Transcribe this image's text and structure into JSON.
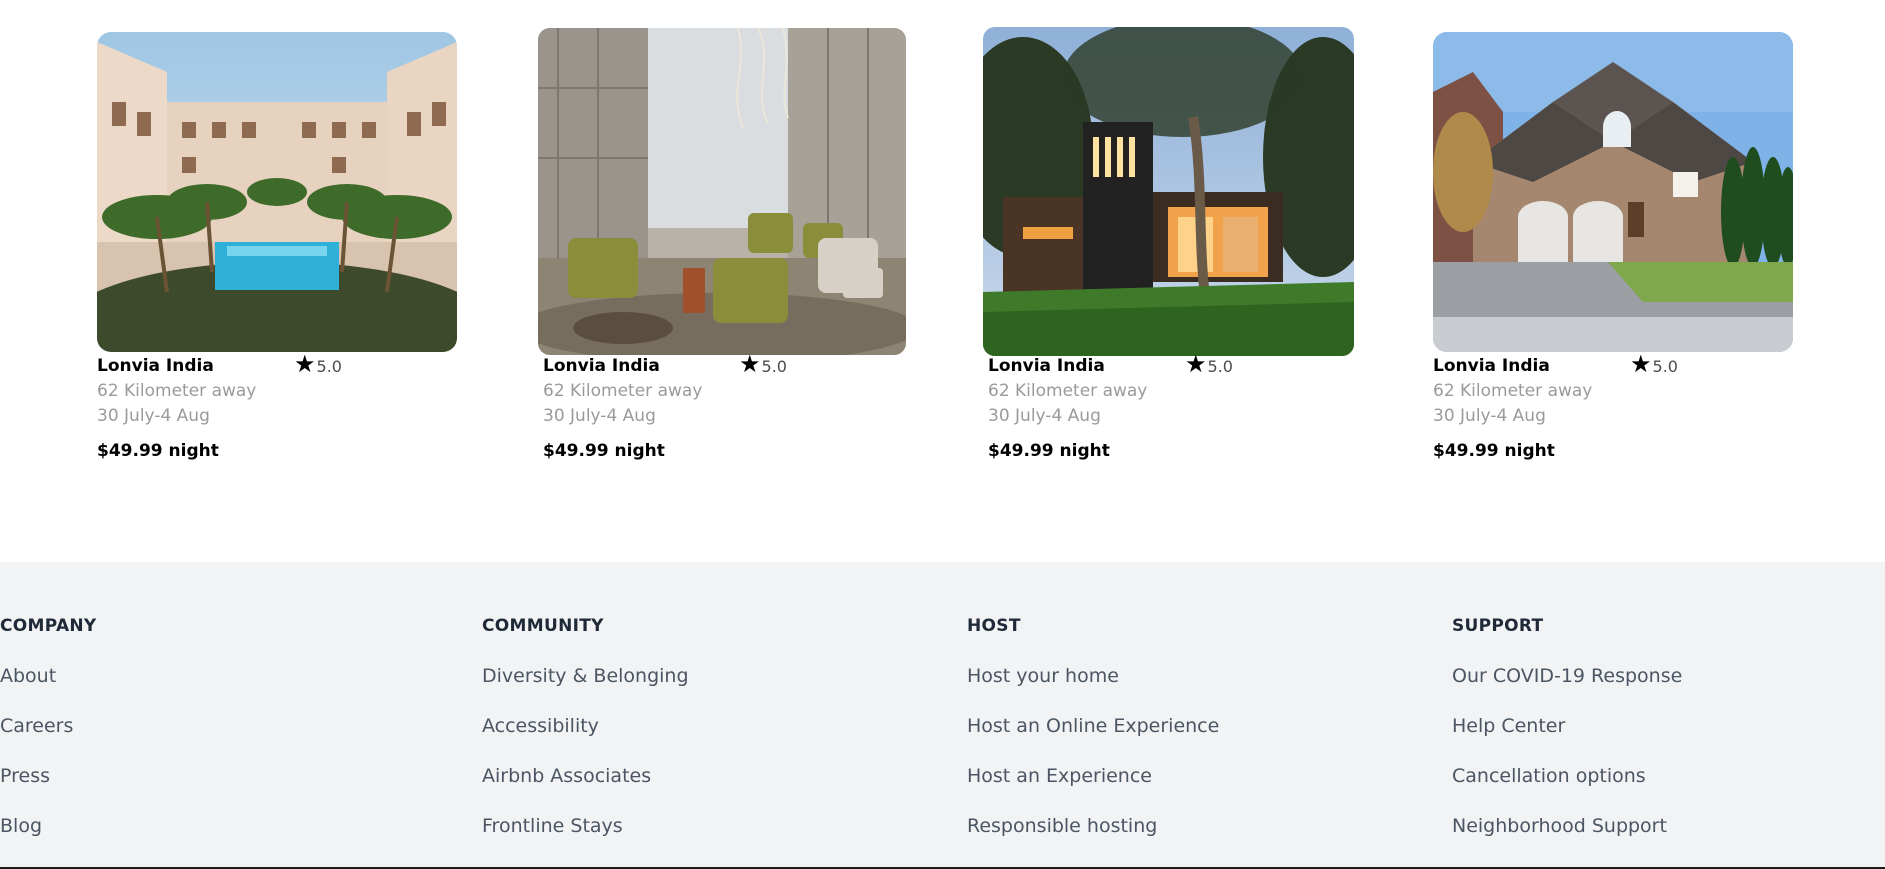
{
  "listings": [
    {
      "title": "Lonvia India",
      "rating": "5.0",
      "distance": "62 Kilometer away",
      "dates": "30 July-4 Aug",
      "price": "$49.99 night",
      "image": "courtyard-pool-hotel"
    },
    {
      "title": "Lonvia India",
      "rating": "5.0",
      "distance": "62 Kilometer away",
      "dates": "30 July-4 Aug",
      "price": "$49.99 night",
      "image": "hotel-lobby-lounge"
    },
    {
      "title": "Lonvia India",
      "rating": "5.0",
      "distance": "62 Kilometer away",
      "dates": "30 July-4 Aug",
      "price": "$49.99 night",
      "image": "modern-house-night"
    },
    {
      "title": "Lonvia India",
      "rating": "5.0",
      "distance": "62 Kilometer away",
      "dates": "30 July-4 Aug",
      "price": "$49.99 night",
      "image": "brick-suburban-house"
    }
  ],
  "footer": {
    "columns": [
      {
        "heading": "COMPANY",
        "links": [
          "About",
          "Careers",
          "Press",
          "Blog"
        ]
      },
      {
        "heading": "COMMUNITY",
        "links": [
          "Diversity & Belonging",
          "Accessibility",
          "Airbnb Associates",
          "Frontline Stays"
        ]
      },
      {
        "heading": "HOST",
        "links": [
          "Host your home",
          "Host an Online Experience",
          "Host an Experience",
          "Responsible hosting"
        ]
      },
      {
        "heading": "SUPPORT",
        "links": [
          "Our COVID-19 Response",
          "Help Center",
          "Cancellation options",
          "Neighborhood Support"
        ]
      }
    ]
  },
  "colors": {
    "footer_bg": "#f2f3f5",
    "muted_text": "#9a9a9a",
    "footer_link": "#4b5563"
  }
}
